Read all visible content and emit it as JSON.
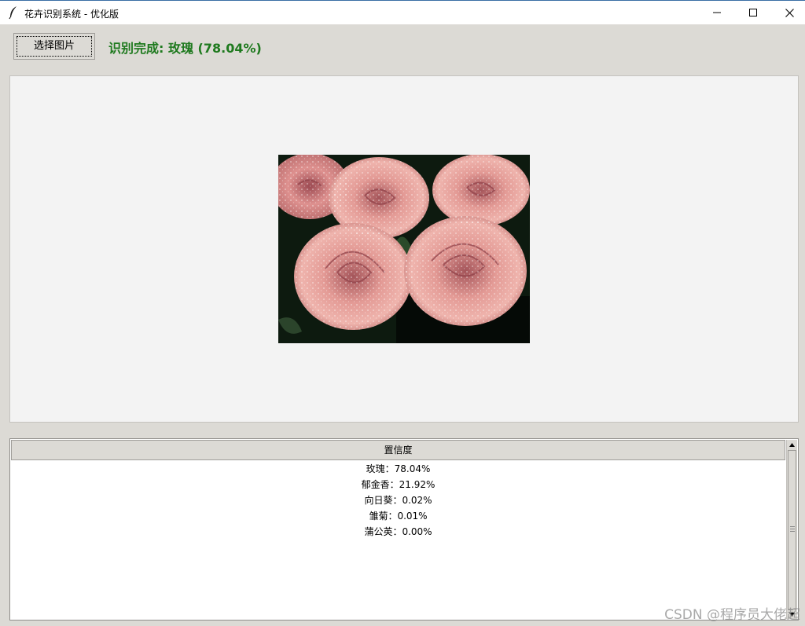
{
  "window": {
    "title": "花卉识别系统 - 优化版",
    "icon": "feather-icon",
    "controls": [
      "minimize-icon",
      "maximize-icon",
      "close-icon"
    ]
  },
  "toolbar": {
    "select_button_label": "选择图片",
    "status_text": "识别完成: 玫瑰 (78.04%)",
    "status_color": "#1f7a1f"
  },
  "image_panel": {
    "image_description": "photo of pink roses covered with water droplets"
  },
  "results": {
    "column_header": "置信度",
    "rows": [
      "玫瑰：78.04%",
      "郁金香：21.92%",
      "向日葵：0.02%",
      "雏菊：0.01%",
      "蒲公英：0.00%"
    ]
  },
  "watermark": "CSDN @程序员大佬超"
}
